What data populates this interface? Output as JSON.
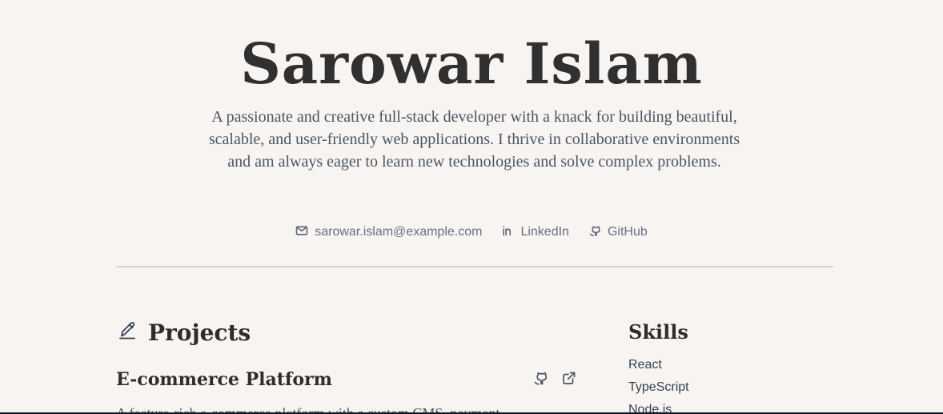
{
  "hero": {
    "name": "Sarowar Islam",
    "bio": "A passionate and creative full-stack developer with a knack for building beautiful, scalable, and user-friendly web applications. I thrive in collaborative environments and am always eager to learn new technologies and solve complex problems."
  },
  "contacts": [
    {
      "label": "sarowar.islam@example.com",
      "icon": "mail-icon"
    },
    {
      "label": "LinkedIn",
      "icon": "linkedin-icon"
    },
    {
      "label": "GitHub",
      "icon": "github-icon"
    }
  ],
  "projects": {
    "title": "Projects",
    "icon": "pen-icon",
    "items": [
      {
        "title": "E-commerce Platform",
        "description": "A feature-rich e-commerce platform with a custom CMS, payment",
        "actions": [
          "github-icon",
          "external-link-icon"
        ]
      }
    ]
  },
  "skills": {
    "title": "Skills",
    "items": [
      "React",
      "TypeScript",
      "Node.js"
    ]
  },
  "colors": {
    "background": "#f7f4f1",
    "text": "#2f2f2f",
    "muted_text": "#4b5563",
    "divider": "#cbd5e1"
  }
}
